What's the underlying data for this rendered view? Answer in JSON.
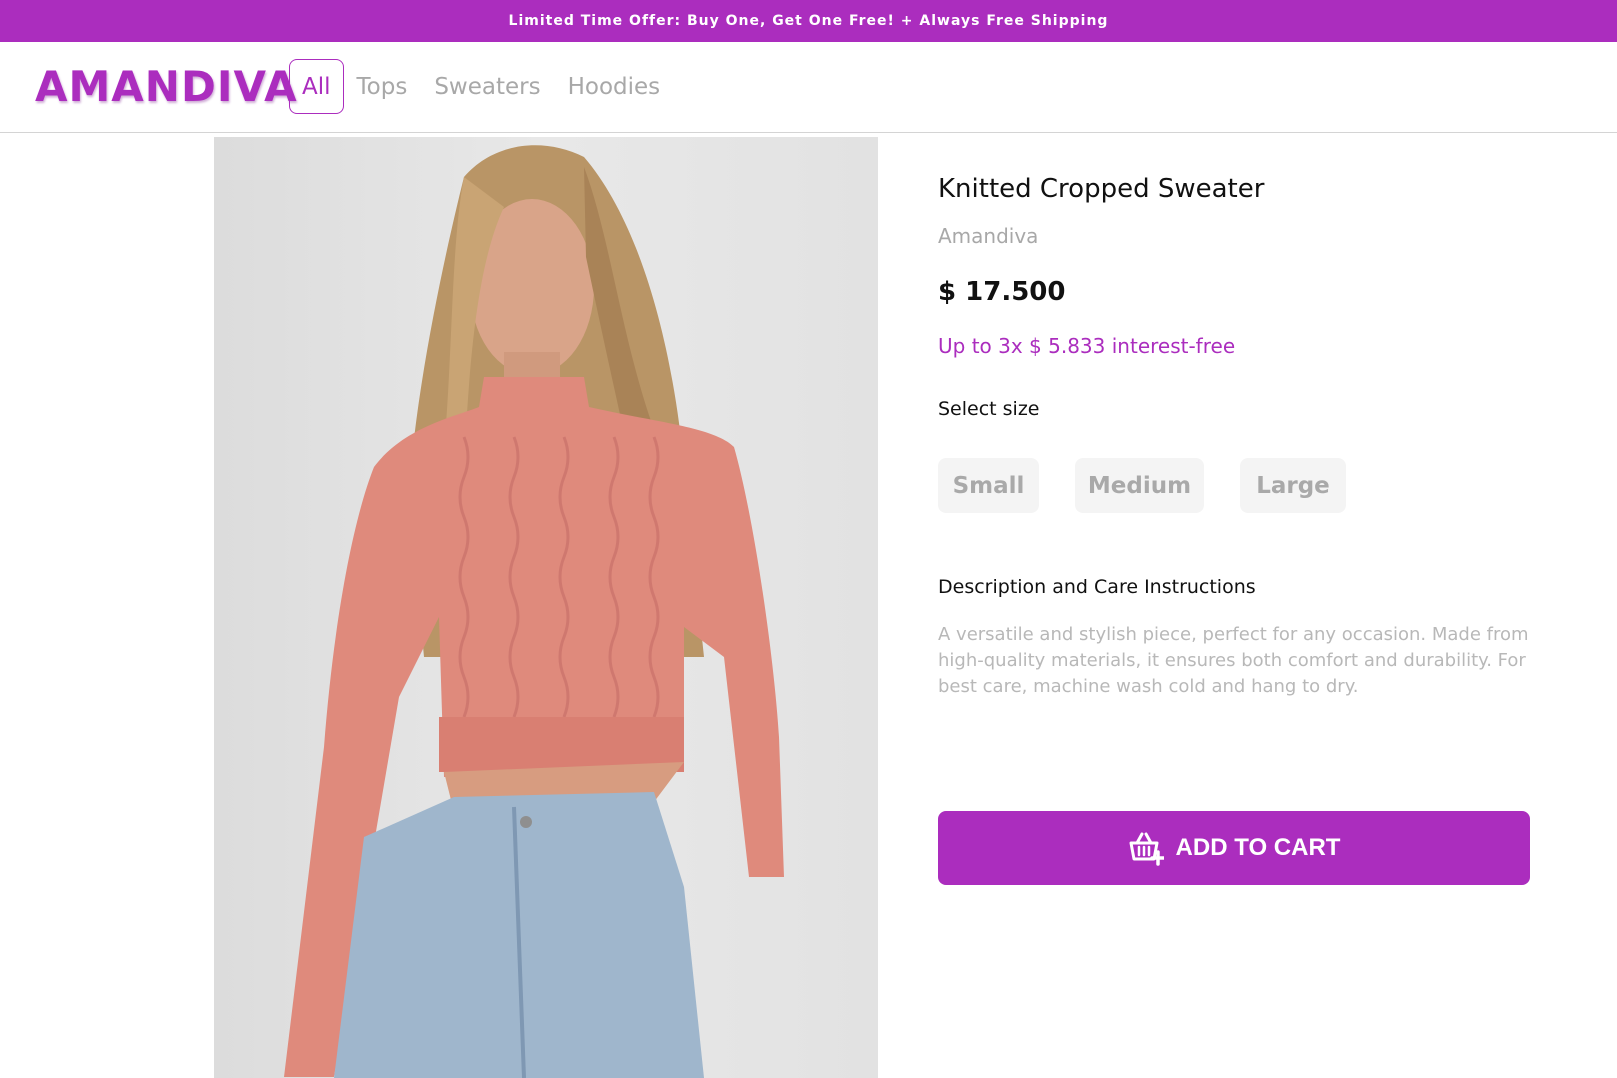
{
  "promo": {
    "text": "Limited Time Offer: Buy One, Get One Free! + Always Free Shipping"
  },
  "header": {
    "logo": "AMANDIVA",
    "nav": [
      "All",
      "Tops",
      "Sweaters",
      "Hoodies"
    ],
    "active_nav": "All"
  },
  "product": {
    "title": "Knitted Cropped Sweater",
    "brand": "Amandiva",
    "price": "$ 17.500",
    "installments": "Up to 3x $ 5.833 interest-free",
    "size_label": "Select size",
    "sizes": [
      "Small",
      "Medium",
      "Large"
    ],
    "description_label": "Description and Care Instructions",
    "description": "A versatile and stylish piece, perfect for any occasion. Made from high-quality materials, it ensures both comfort and durability. For best care, machine wash cold and hang to dry.",
    "add_to_cart": "ADD TO CART",
    "image_icon": "product-photo"
  },
  "colors": {
    "accent": "#ab2dbe",
    "muted_text": "#a8a8a8",
    "size_bg": "#f4f4f4"
  }
}
